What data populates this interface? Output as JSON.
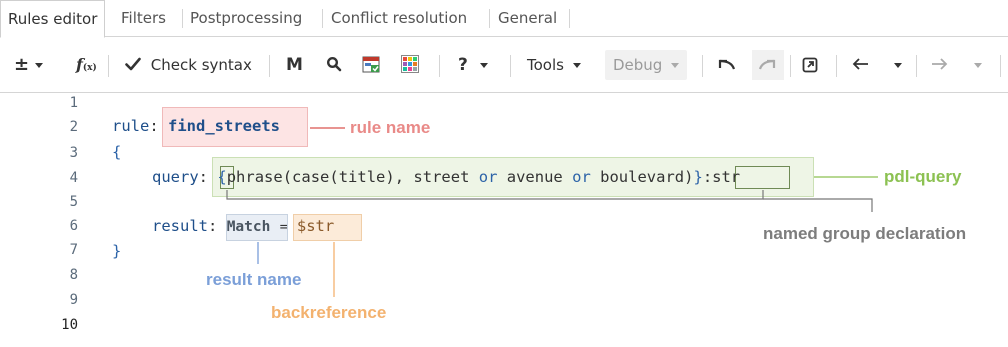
{
  "tabs": [
    {
      "label": "Rules editor",
      "active": true
    },
    {
      "label": "Filters"
    },
    {
      "label": "Postprocessing"
    },
    {
      "label": "Conflict resolution"
    },
    {
      "label": "General"
    }
  ],
  "toolbar": {
    "plus_minus": "±",
    "fx": "f",
    "fx_sub": "(x)",
    "check_syntax": "Check syntax",
    "m_label": "M",
    "help": "?",
    "tools": "Tools",
    "debug": "Debug"
  },
  "editor": {
    "line_numbers": [
      "1",
      "2",
      "3",
      "4",
      "5",
      "6",
      "7",
      "8",
      "9",
      "10"
    ],
    "line2": {
      "keyword": "rule",
      "colon": ":",
      "name": "find_streets"
    },
    "line3": "{",
    "line4": {
      "label": "query",
      "colon": ":",
      "open": "{",
      "func1": "phrase",
      "p1": "(",
      "func2": "case",
      "p2": "(",
      "arg": "title",
      "p3": "),",
      "w1": "street",
      "or1": "or",
      "w2": "avenue",
      "or2": "or",
      "w3": "boulevard",
      "p4": ")",
      "close": "}",
      "group": ":str"
    },
    "line6": {
      "label": "result",
      "colon": ":",
      "match": "Match",
      "eq": "=",
      "ref": "$str"
    },
    "line7": "}"
  },
  "annotations": {
    "rule_name": "rule name",
    "pdl_query": "pdl-query",
    "named_group": "named group declaration",
    "result_name": "result name",
    "backreference": "backreference"
  },
  "colors": {
    "rule_name": "#e98a88",
    "pdl_query": "#8cc152",
    "named_group": "#7d7d7d",
    "result_name": "#7b9fd8",
    "backreference": "#f3b26f"
  }
}
